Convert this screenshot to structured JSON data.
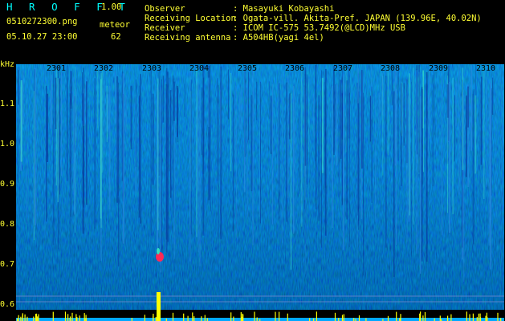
{
  "app": {
    "title": "H R O F F T",
    "version": "1.00"
  },
  "file": {
    "name": "0510272300.png",
    "datetime": "05.10.27 23:00"
  },
  "meteor": {
    "label": "meteor",
    "count": "62"
  },
  "info": {
    "labels": [
      "Observer",
      "Receiving Location",
      "Receiver",
      "Receiving antenna"
    ],
    "values": [
      ": Masayuki Kobayashi",
      ": Ogata-vill. Akita-Pref. JAPAN (139.96E, 40.02N)",
      ": ICOM IC-575 53.7492(@LCD)MHz USB",
      ": A504HB(yagi 4el)"
    ]
  },
  "axis": {
    "unit": "kHz",
    "y_ticks": [
      "1.1",
      "1.0",
      "0.9",
      "0.8",
      "0.7",
      "0.6"
    ],
    "x_ticks": [
      "2301",
      "2302",
      "2303",
      "2304",
      "2305",
      "2306",
      "2307",
      "2308",
      "2309",
      "2310"
    ]
  },
  "colors": {
    "text_primary": "#ffff33",
    "text_secondary": "#00ffff",
    "background": "#000000",
    "spectrum_base": "#06106e",
    "spectrum_mid": "#1a6fd0",
    "spectrum_high": "#30e0c0",
    "meteor_echo": "#ff2a55",
    "baseline": "#ffff00"
  }
}
